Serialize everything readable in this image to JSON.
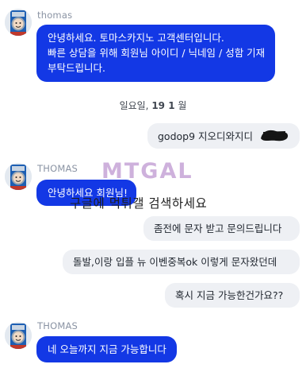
{
  "conversation": [
    {
      "type": "agent",
      "sender": "thomas",
      "lines": [
        "안녕하세요. 토마스카지노 고객센터입니다.",
        "빠른 상담을 위해 회원님 아이디 / 닉네임 / 성함 기재",
        "부탁드립니다."
      ]
    },
    {
      "type": "date",
      "day": "일요일,",
      "date": "19 1",
      "suffix": "월"
    },
    {
      "type": "user",
      "text": "godop9 지오디와지디"
    },
    {
      "type": "agent",
      "sender": "THOMAS",
      "lines": [
        "안녕하세요 회원님!"
      ]
    },
    {
      "type": "user",
      "text": "좀전에 문자 받고 문의드립니다"
    },
    {
      "type": "user",
      "text": "돌발,이랑 입플 뉴 이벤중복ok 이렇게 문자왔던데"
    },
    {
      "type": "user",
      "text": "혹시 지금 가능한건가요??"
    },
    {
      "type": "agent",
      "sender": "THOMAS",
      "lines": [
        "네 오늘까지 지금 가능합니다"
      ]
    }
  ],
  "watermark": {
    "logo_text": "MTGAL",
    "text": "구글에 먹튀갤 검색하세요"
  },
  "colors": {
    "agent_bubble": "#1338e5",
    "user_bubble": "#eef0f4",
    "sender_name": "#8a93a3"
  },
  "icons": {
    "avatar": "train-engine-avatar-icon",
    "redaction": "black-scribble-redaction"
  }
}
